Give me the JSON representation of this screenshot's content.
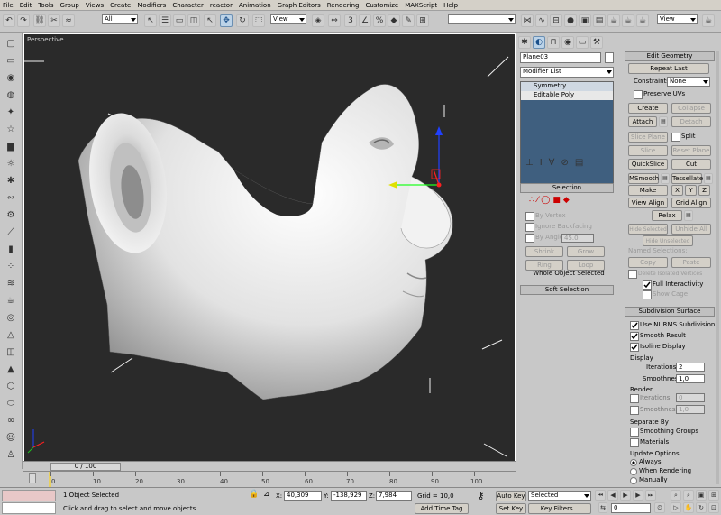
{
  "menu": [
    "File",
    "Edit",
    "Tools",
    "Group",
    "Views",
    "Create",
    "Modifiers",
    "Character",
    "reactor",
    "Animation",
    "Graph Editors",
    "Rendering",
    "Customize",
    "MAXScript",
    "Help"
  ],
  "toolbar": {
    "filter_value": "All",
    "refcoord_value": "View",
    "named_sel_value": "",
    "view_dropdown": "View"
  },
  "viewport": {
    "label": "Perspective"
  },
  "timeline": {
    "frame_label": "0 / 100",
    "ticks": [
      "0",
      "10",
      "20",
      "30",
      "40",
      "50",
      "60",
      "70",
      "80",
      "90",
      "100"
    ]
  },
  "panel": {
    "object_name": "Plane03",
    "modifier_list": "Modifier List",
    "stack": [
      "Symmetry",
      "Editable Poly"
    ],
    "selection_header": "Selection",
    "by_vertex": "By Vertex",
    "ignore_backfacing": "Ignore Backfacing",
    "by_angle": "By Angle",
    "by_angle_value": "45.0",
    "shrink": "Shrink",
    "grow": "Grow",
    "ring": "Ring",
    "loop": "Loop",
    "whole_object": "Whole Object Selected",
    "soft_selection": "Soft Selection",
    "edit_geometry": "Edit Geometry",
    "repeat_last": "Repeat Last",
    "constraints_label": "Constraints:",
    "constraints_value": "None",
    "preserve_uvs": "Preserve UVs",
    "create": "Create",
    "collapse": "Collapse",
    "attach": "Attach",
    "detach": "Detach",
    "slice_plane": "Slice Plane",
    "split": "Split",
    "slice": "Slice",
    "reset_plane": "Reset Plane",
    "quickslice": "QuickSlice",
    "cut": "Cut",
    "msmooth": "MSmooth",
    "tessellate": "Tessellate",
    "make_planar": "Make Planar",
    "x": "X",
    "y": "Y",
    "z": "Z",
    "view_align": "View Align",
    "grid_align": "Grid Align",
    "relax": "Relax",
    "hide_selected": "Hide Selected",
    "unhide_all": "Unhide All",
    "hide_unselected": "Hide Unselected",
    "named_selections": "Named Selections:",
    "copy": "Copy",
    "paste": "Paste",
    "delete_isolated": "Delete Isolated Vertices",
    "full_interactivity": "Full Interactivity",
    "show_cage": "Show Cage",
    "subdiv_header": "Subdivision Surface",
    "use_nurms": "Use NURMS Subdivision",
    "smooth_result": "Smooth Result",
    "isoline_display": "Isoline Display",
    "display_label": "Display",
    "iterations_label": "Iterations:",
    "iterations_value": "2",
    "smoothness_label": "Smoothness:",
    "smoothness_value": "1,0",
    "render_label": "Render",
    "r_iterations_value": "0",
    "r_smoothness_value": "1,0",
    "separate_by": "Separate By",
    "smoothing_groups": "Smoothing Groups",
    "materials": "Materials",
    "update_options": "Update Options",
    "always": "Always",
    "when_rendering": "When Rendering",
    "manually": "Manually"
  },
  "status": {
    "selected": "1 Object Selected",
    "prompt": "Click and drag to select and move objects",
    "x_label": "X:",
    "x_value": "40,309",
    "y_label": "Y:",
    "y_value": "-138,929",
    "z_label": "Z:",
    "z_value": "7,984",
    "grid": "Grid = 10,0",
    "add_time_tag": "Add Time Tag",
    "auto_key": "Auto Key",
    "set_key": "Set Key",
    "key_mode_value": "Selected",
    "key_filters": "Key Filters...",
    "frame_value": "0"
  }
}
